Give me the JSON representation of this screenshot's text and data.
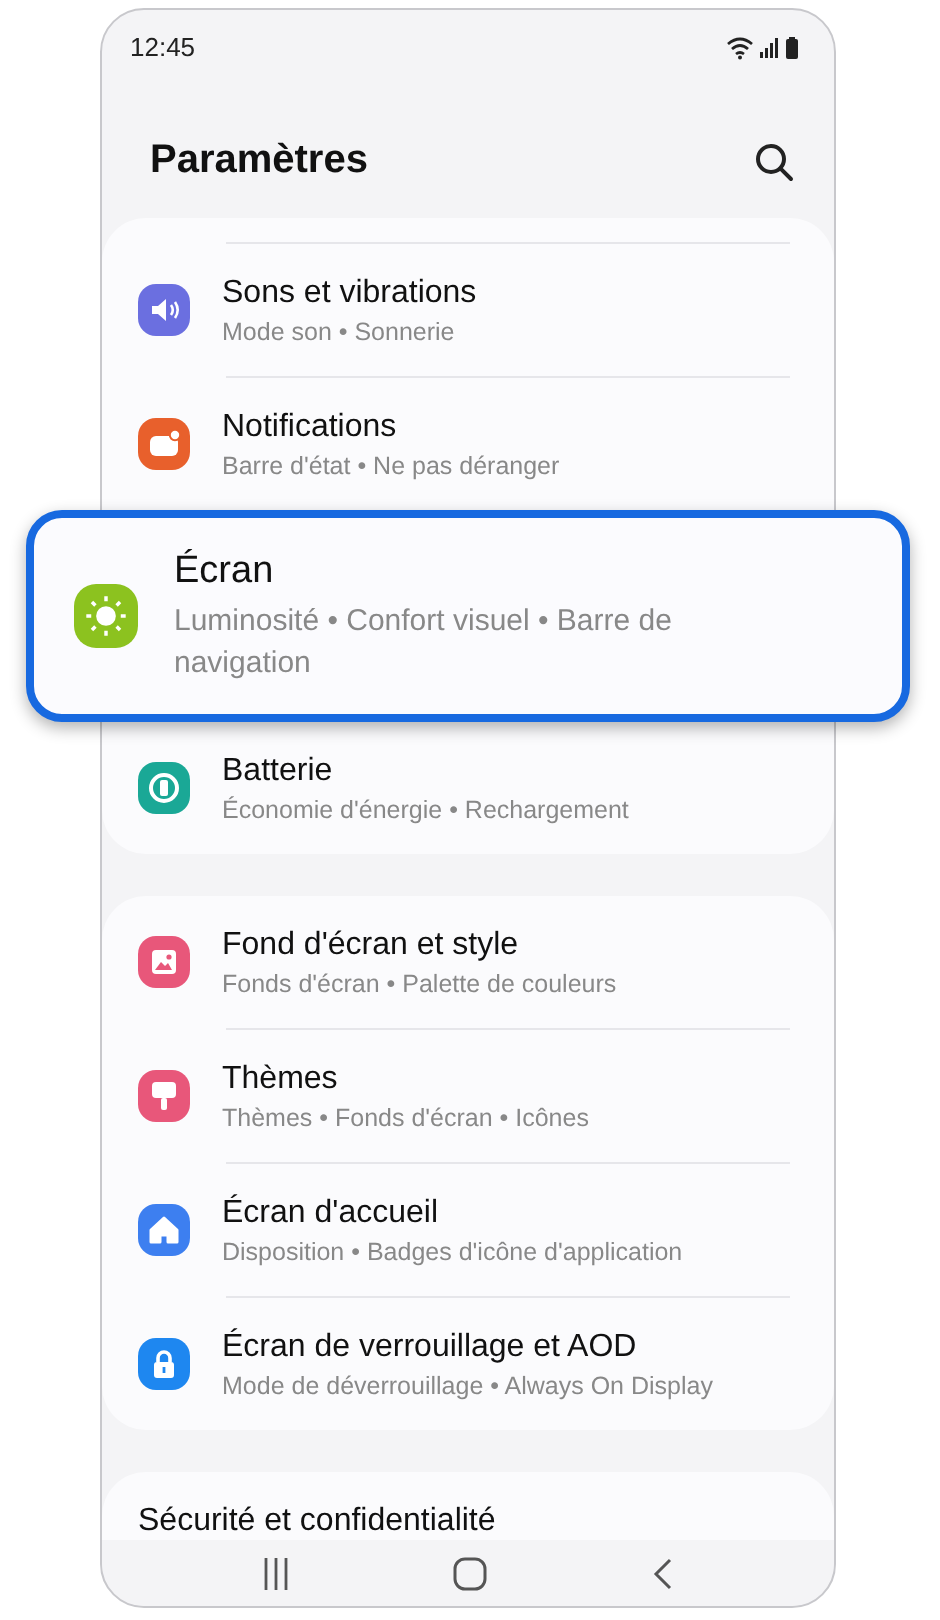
{
  "status_bar": {
    "time": "12:45"
  },
  "header": {
    "title": "Paramètres"
  },
  "groups": [
    {
      "items": [
        {
          "title": "Sons et vibrations",
          "subtitle": "Mode son • Sonnerie",
          "color": "#6b6fe0",
          "highlighted": false
        },
        {
          "title": "Notifications",
          "subtitle": "Barre d'état • Ne pas déranger",
          "color": "#e8602c",
          "highlighted": false
        },
        {
          "title": "Écran",
          "subtitle": "Luminosité • Confort visuel • Barre de navigation",
          "color": "#8cc21f",
          "highlighted": true
        },
        {
          "title": "Batterie",
          "subtitle": "Économie d'énergie • Rechargement",
          "color": "#1aa896",
          "highlighted": false
        }
      ]
    },
    {
      "items": [
        {
          "title": "Fond d'écran et style",
          "subtitle": "Fonds d'écran • Palette de couleurs",
          "color": "#e8577a",
          "highlighted": false
        },
        {
          "title": "Thèmes",
          "subtitle": "Thèmes • Fonds d'écran • Icônes",
          "color": "#e8577a",
          "highlighted": false
        },
        {
          "title": "Écran d'accueil",
          "subtitle": "Disposition • Badges d'icône d'application",
          "color": "#3d7ff0",
          "highlighted": false
        },
        {
          "title": "Écran de verrouillage et AOD",
          "subtitle": "Mode de déverrouillage • Always On Display",
          "color": "#1e87f0",
          "highlighted": false
        }
      ]
    },
    {
      "items": [
        {
          "title": "Sécurité et confidentialité"
        }
      ]
    }
  ]
}
